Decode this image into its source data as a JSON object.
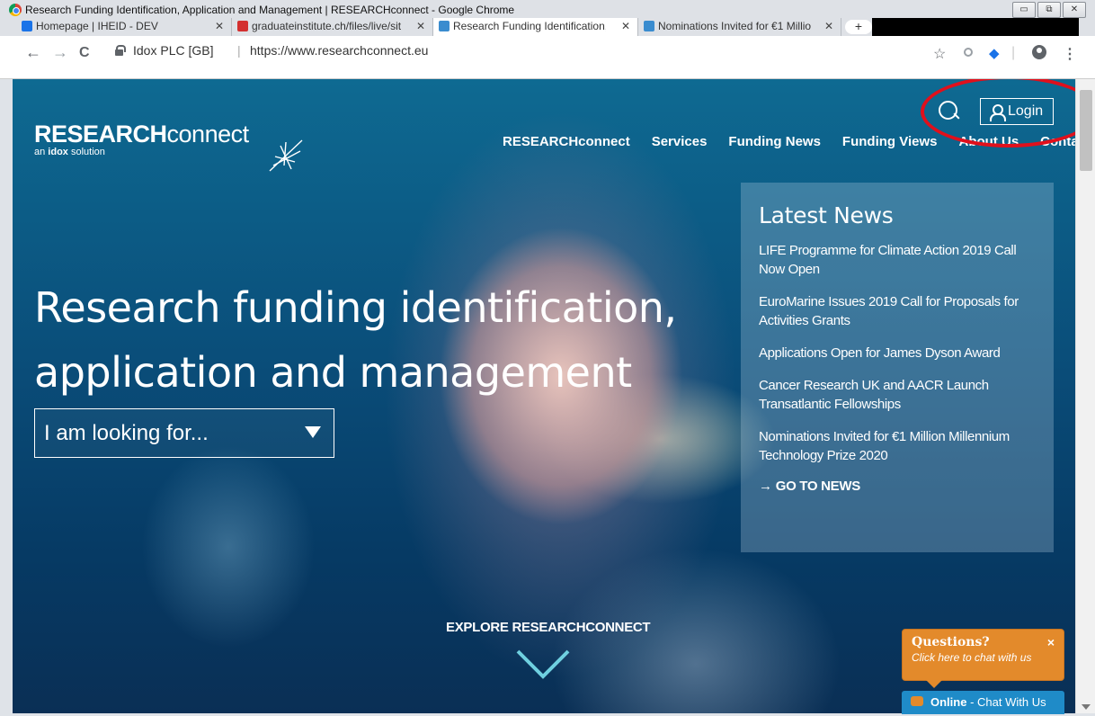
{
  "window": {
    "title": "Research Funding Identification, Application and Management | RESEARCHconnect - Google Chrome",
    "controls": [
      "▭",
      "⧉",
      "✕"
    ]
  },
  "tabs": [
    {
      "label": "Homepage | IHEID - DEV",
      "favicon_color": "#1a73e8",
      "active": false
    },
    {
      "label": "graduateinstitute.ch/files/live/sit",
      "favicon_color": "#d32f2f",
      "active": false
    },
    {
      "label": "Research Funding Identification, ",
      "favicon_color": "#3a8ccf",
      "active": true
    },
    {
      "label": "Nominations Invited for €1 Millio",
      "favicon_color": "#3a8ccf",
      "active": false
    }
  ],
  "toolbar": {
    "back": "←",
    "forward": "→",
    "reload": "C",
    "site_identity": "Idox PLC [GB]",
    "separator": "|",
    "url": "https://www.researchconnect.eu",
    "star": "☆",
    "menu": "⋮"
  },
  "site": {
    "logo_main_bold": "RESEARCH",
    "logo_main_thin": "connect",
    "logo_sub_prefix": "an ",
    "logo_sub_bold": "idox",
    "logo_sub_suffix": " solution",
    "login_label": "Login",
    "nav": [
      "RESEARCHconnect",
      "Services",
      "Funding News",
      "Funding Views",
      "About Us",
      "Contact"
    ],
    "headline": "Research funding identification, application and management",
    "looking_for": "I am looking for...",
    "explore": "EXPLORE RESEARCHCONNECT"
  },
  "news": {
    "title": "Latest News",
    "items": [
      "LIFE Programme for Climate Action 2019 Call Now Open",
      "EuroMarine Issues 2019 Call for Proposals for Activities Grants",
      "Applications Open for James Dyson Award",
      "Cancer Research UK and AACR Launch Transatlantic Fellowships",
      "Nominations Invited for €1 Million Millennium Technology Prize 2020"
    ],
    "go_arrow": "→",
    "go_label": "GO TO NEWS"
  },
  "chat": {
    "question": "Questions?",
    "subtitle": "Click here to chat with us",
    "close": "×",
    "online_bold": "Online",
    "online_rest": " - Chat With Us"
  },
  "colors": {
    "annotation_red": "#e0101c",
    "chat_orange": "#e38a2b",
    "online_blue": "#1f8bc8"
  }
}
